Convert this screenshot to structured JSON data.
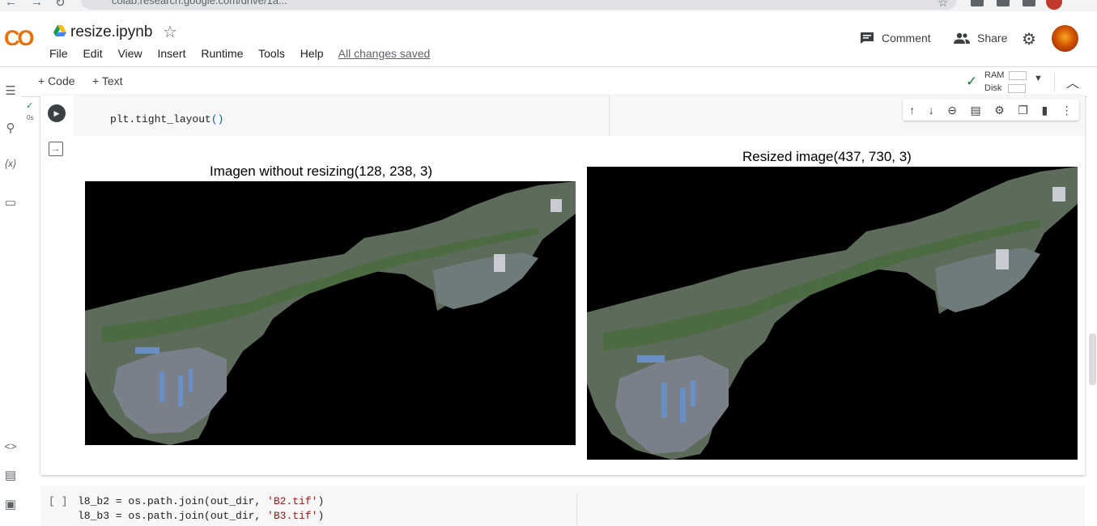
{
  "browser": {
    "url": "colab.research.google.com/drive/1a..."
  },
  "header": {
    "logo": "CO",
    "notebook_title": "resize.ipynb",
    "menu": [
      "File",
      "Edit",
      "View",
      "Insert",
      "Runtime",
      "Tools",
      "Help"
    ],
    "save_status": "All changes saved",
    "comment_label": "Comment",
    "share_label": "Share"
  },
  "toolbar": {
    "add_code": "+ Code",
    "add_text": "+ Text",
    "ram_label": "RAM",
    "disk_label": "Disk"
  },
  "sidebar": {
    "items": [
      "table-of-contents-icon",
      "search-icon",
      "variables-icon",
      "files-icon",
      "code-snippets-icon",
      "command-palette-icon",
      "terminal-icon"
    ],
    "variables_glyph": "{x}"
  },
  "cell": {
    "exec_time": "0s",
    "code": "plt.tight_layout",
    "code_parens": "()",
    "tools": [
      "arrow-up-icon",
      "arrow-down-icon",
      "link-icon",
      "comment-icon",
      "settings-icon",
      "mirror-icon",
      "delete-icon",
      "more-icon"
    ]
  },
  "output": {
    "left_title": "Imagen without resizing(128, 238, 3)",
    "right_title": "Resized image(437, 730, 3)"
  },
  "next_cell": {
    "brackets": "[ ]",
    "line1": {
      "prefix": "l8_b2 = os.path.join(out_dir, ",
      "str": "'B2.tif'",
      "suffix": ")"
    },
    "line2": {
      "prefix": "l8_b3 = os.path.join(out_dir, ",
      "str": "'B3.tif'",
      "suffix": ")"
    }
  },
  "colors": {
    "accent": "#f9ab00",
    "brand_orange": "#e8710a",
    "success": "#188038"
  }
}
